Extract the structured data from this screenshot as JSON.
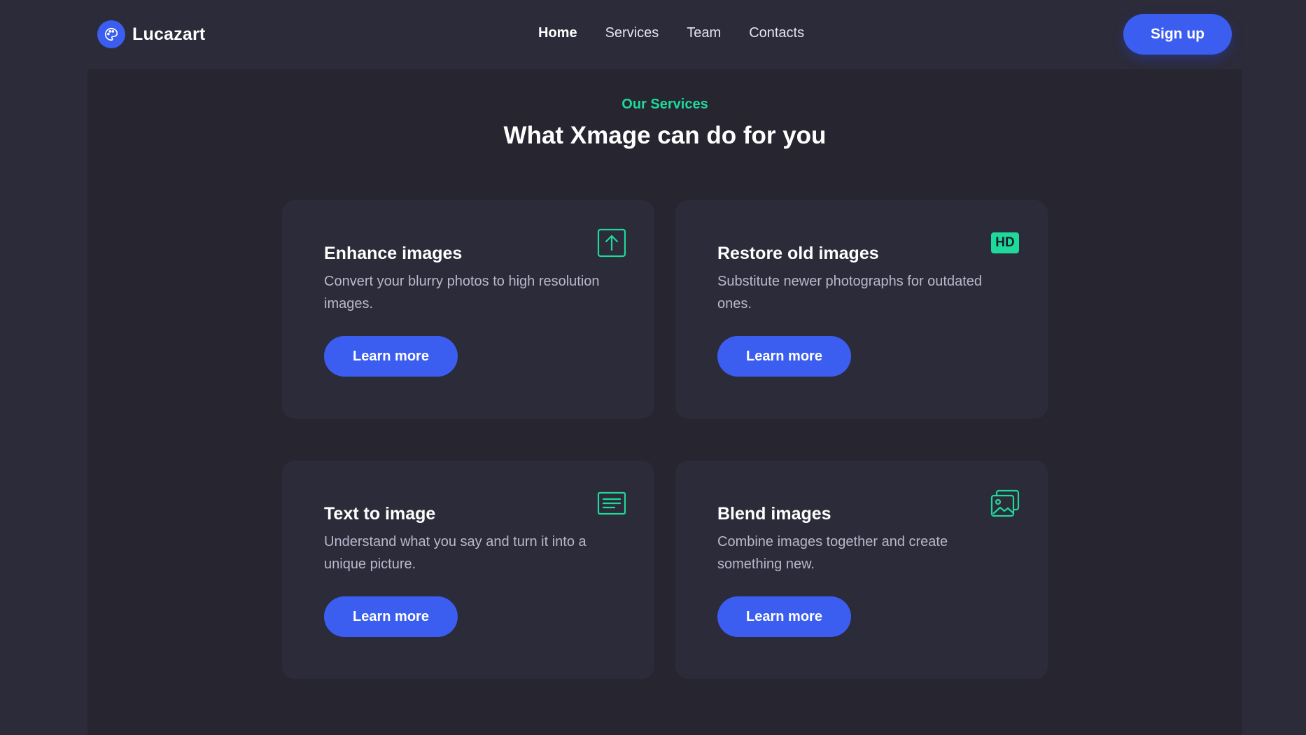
{
  "header": {
    "brand": "Lucazart",
    "nav": [
      {
        "label": "Home"
      },
      {
        "label": "Services"
      },
      {
        "label": "Team"
      },
      {
        "label": "Contacts"
      }
    ],
    "signup_label": "Sign up"
  },
  "services": {
    "eyebrow": "Our Services",
    "title": "What Xmage can do for you",
    "cards": [
      {
        "title": "Enhance images",
        "description": "Convert your blurry photos to high resolution images.",
        "button": "Learn more",
        "icon": "upload-arrow-icon"
      },
      {
        "title": "Restore old images",
        "description": "Substitute newer photographs for outdated ones.",
        "button": "Learn more",
        "icon": "hd-badge-icon",
        "badge": "HD"
      },
      {
        "title": "Text to image",
        "description": "Understand what you say and turn it into a unique picture.",
        "button": "Learn more",
        "icon": "text-lines-icon"
      },
      {
        "title": "Blend images",
        "description": "Combine images together and create something new.",
        "button": "Learn more",
        "icon": "images-stack-icon"
      }
    ]
  },
  "colors": {
    "background": "#2c2b39",
    "section_background": "#262530",
    "accent_blue": "#3b5ef0",
    "accent_green": "#1fd99b"
  }
}
